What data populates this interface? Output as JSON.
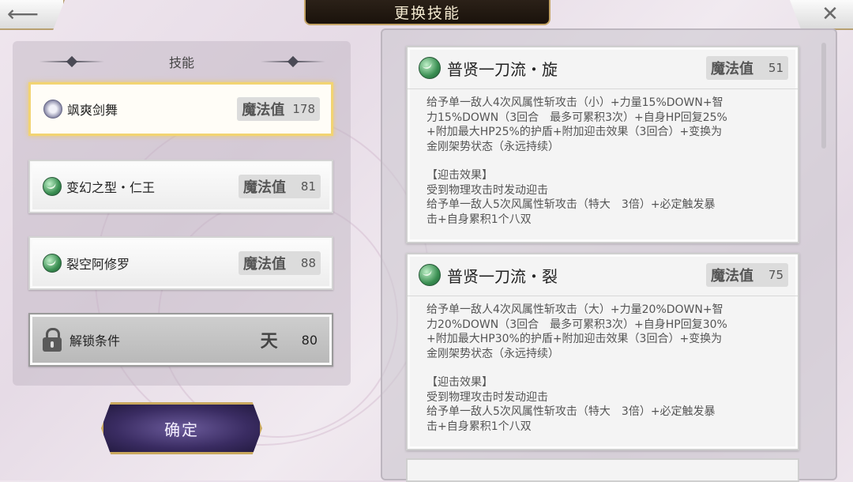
{
  "header": {
    "title": "更换技能",
    "back_icon": "back-arrow-icon",
    "close_icon": "close-icon"
  },
  "left": {
    "section_label": "技能",
    "mp_label": "魔法值",
    "skills": [
      {
        "name": "飒爽剑舞",
        "mp": "178",
        "icon": "flower-icon",
        "selected": true
      },
      {
        "name": "变幻之型・仁王",
        "mp": "81",
        "icon": "wind-icon"
      },
      {
        "name": "裂空阿修罗",
        "mp": "88",
        "icon": "wind-icon"
      }
    ],
    "locked": {
      "label": "解锁条件",
      "symbol": "天",
      "value": "80"
    },
    "confirm_label": "确定"
  },
  "details": [
    {
      "title": "普贤一刀流・旋",
      "mp_label": "魔法值",
      "mp": "51",
      "lines": [
        "给予单一敌人4次风属性斩攻击（小）+力量15%DOWN+智",
        "力15%DOWN（3回合　最多可累积3次）+自身HP回复25%",
        "+附加最大HP25%的护盾+附加迎击效果（3回合）+变换为",
        "金刚架势状态（永远持续）"
      ],
      "counter_lines": [
        "【迎击效果】",
        "受到物理攻击时发动迎击",
        "给予单一敌人5次风属性斩攻击（特大　3倍）+必定触发暴",
        "击+自身累积1个八双"
      ]
    },
    {
      "title": "普贤一刀流・裂",
      "mp_label": "魔法值",
      "mp": "75",
      "lines": [
        "给予单一敌人4次风属性斩攻击（大）+力量20%DOWN+智",
        "力20%DOWN（3回合　最多可累积3次）+自身HP回复30%",
        "+附加最大HP30%的护盾+附加迎击效果（3回合）+变换为",
        "金刚架势状态（永远持续）"
      ],
      "counter_lines": [
        "【迎击效果】",
        "受到物理攻击时发动迎击",
        "给予单一敌人5次风属性斩攻击（特大　3倍）+必定触发暴",
        "击+自身累积1个八双"
      ]
    }
  ],
  "colors": {
    "highlight": "#f2d472",
    "confirm_bg": "#3a2c62",
    "banner_bg": "#1a120b"
  }
}
